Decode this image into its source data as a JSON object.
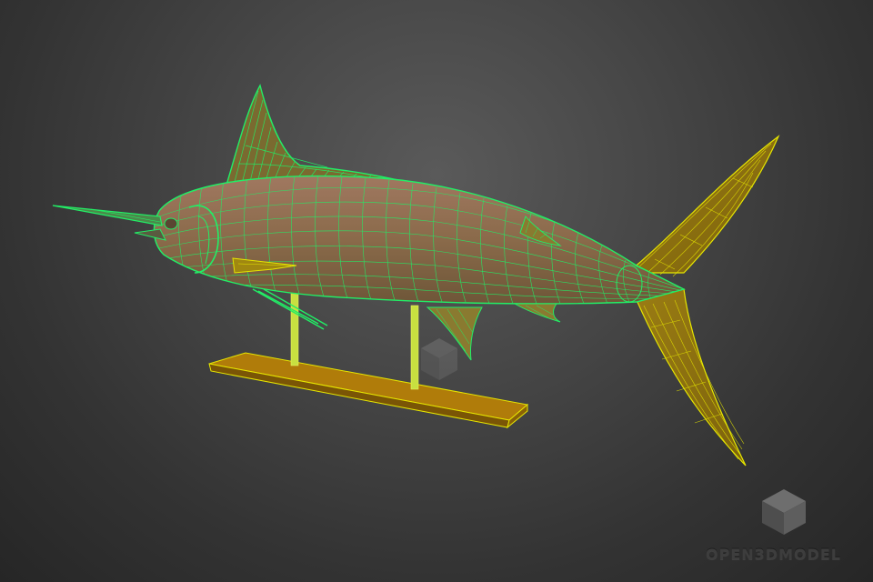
{
  "scene": {
    "subject_icon": "marlin-trophy-wireframe",
    "background_color": "#474747",
    "body_fill_color": "#8a6a4a",
    "wire_color_green": "#22ee66",
    "wire_color_yellow": "#e6e600",
    "fin_fill_color": "#8a7010",
    "stand_base_color": "#a07008",
    "stand_post_color": "#c8e040"
  },
  "watermark": {
    "logo_icon": "cube-icon",
    "text": "OPEN3DMODEL"
  }
}
